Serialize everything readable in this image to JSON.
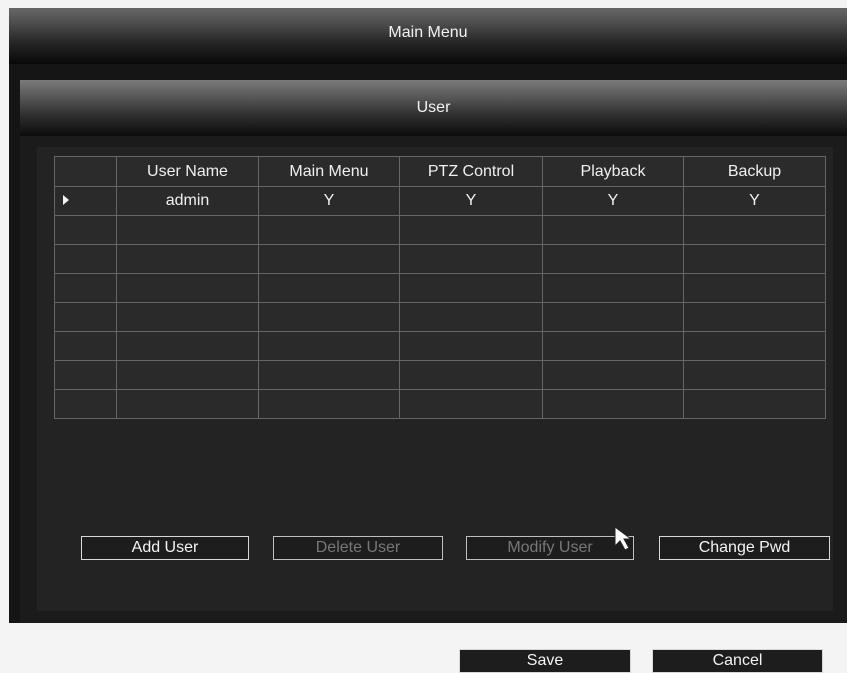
{
  "window": {
    "title": "Main Menu"
  },
  "dialog": {
    "title": "User"
  },
  "table": {
    "columns": [
      "User Name",
      "Main Menu",
      "PTZ Control",
      "Playback",
      "Backup"
    ],
    "rows": [
      {
        "selected": true,
        "user_name": "admin",
        "main_menu": "Y",
        "ptz_control": "Y",
        "playback": "Y",
        "backup": "Y"
      }
    ]
  },
  "buttons": {
    "add_user": "Add User",
    "delete_user": "Delete User",
    "modify_user": "Modify User",
    "change_pwd": "Change Pwd",
    "save": "Save",
    "cancel": "Cancel"
  }
}
